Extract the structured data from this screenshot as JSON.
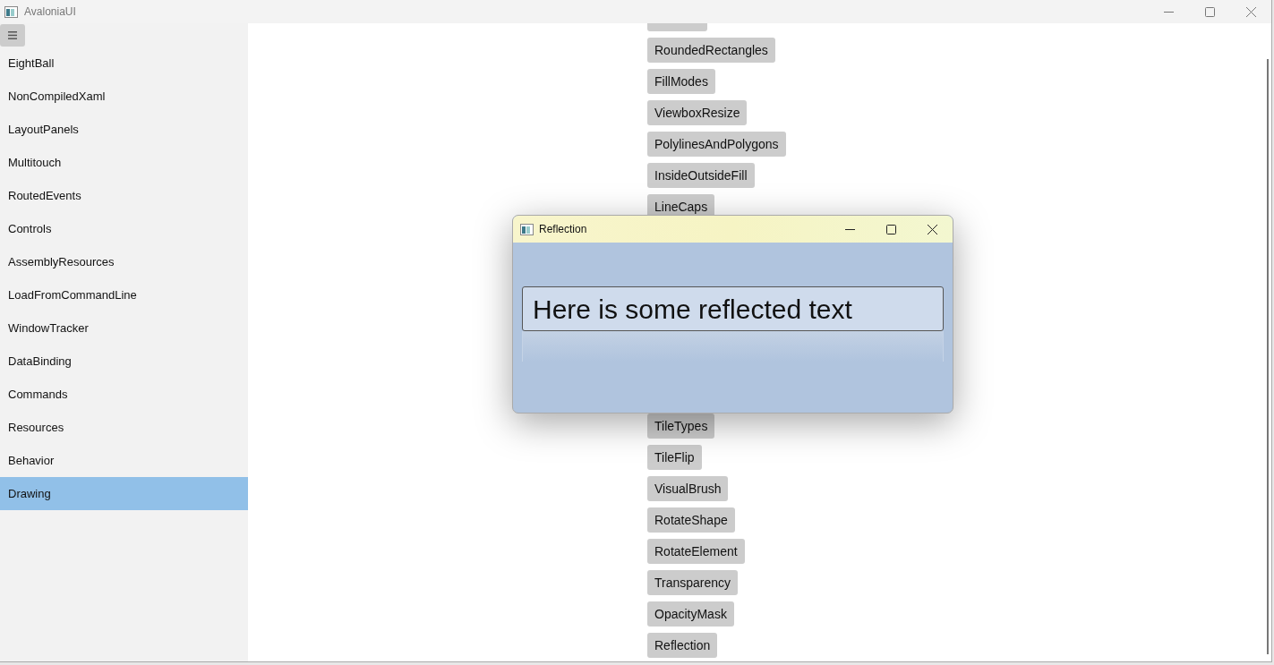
{
  "window": {
    "title": "AvaloniaUI"
  },
  "sidebar": {
    "items": [
      {
        "label": "EightBall",
        "selected": false
      },
      {
        "label": "NonCompiledXaml",
        "selected": false
      },
      {
        "label": "LayoutPanels",
        "selected": false
      },
      {
        "label": "Multitouch",
        "selected": false
      },
      {
        "label": "RoutedEvents",
        "selected": false
      },
      {
        "label": "Controls",
        "selected": false
      },
      {
        "label": "AssemblyResources",
        "selected": false
      },
      {
        "label": "LoadFromCommandLine",
        "selected": false
      },
      {
        "label": "WindowTracker",
        "selected": false
      },
      {
        "label": "DataBinding",
        "selected": false
      },
      {
        "label": "Commands",
        "selected": false
      },
      {
        "label": "Resources",
        "selected": false
      },
      {
        "label": "Behavior",
        "selected": false
      },
      {
        "label": "Drawing",
        "selected": true
      }
    ]
  },
  "examples": [
    "RoundedRectangles",
    "FillModes",
    "ViewboxResize",
    "PolylinesAndPolygons",
    "InsideOutsideFill",
    "LineCaps",
    "TileTypes",
    "TileFlip",
    "VisualBrush",
    "RotateShape",
    "RotateElement",
    "Transparency",
    "OpacityMask",
    "Reflection"
  ],
  "dialog": {
    "title": "Reflection",
    "text": "Here is some reflected text"
  }
}
